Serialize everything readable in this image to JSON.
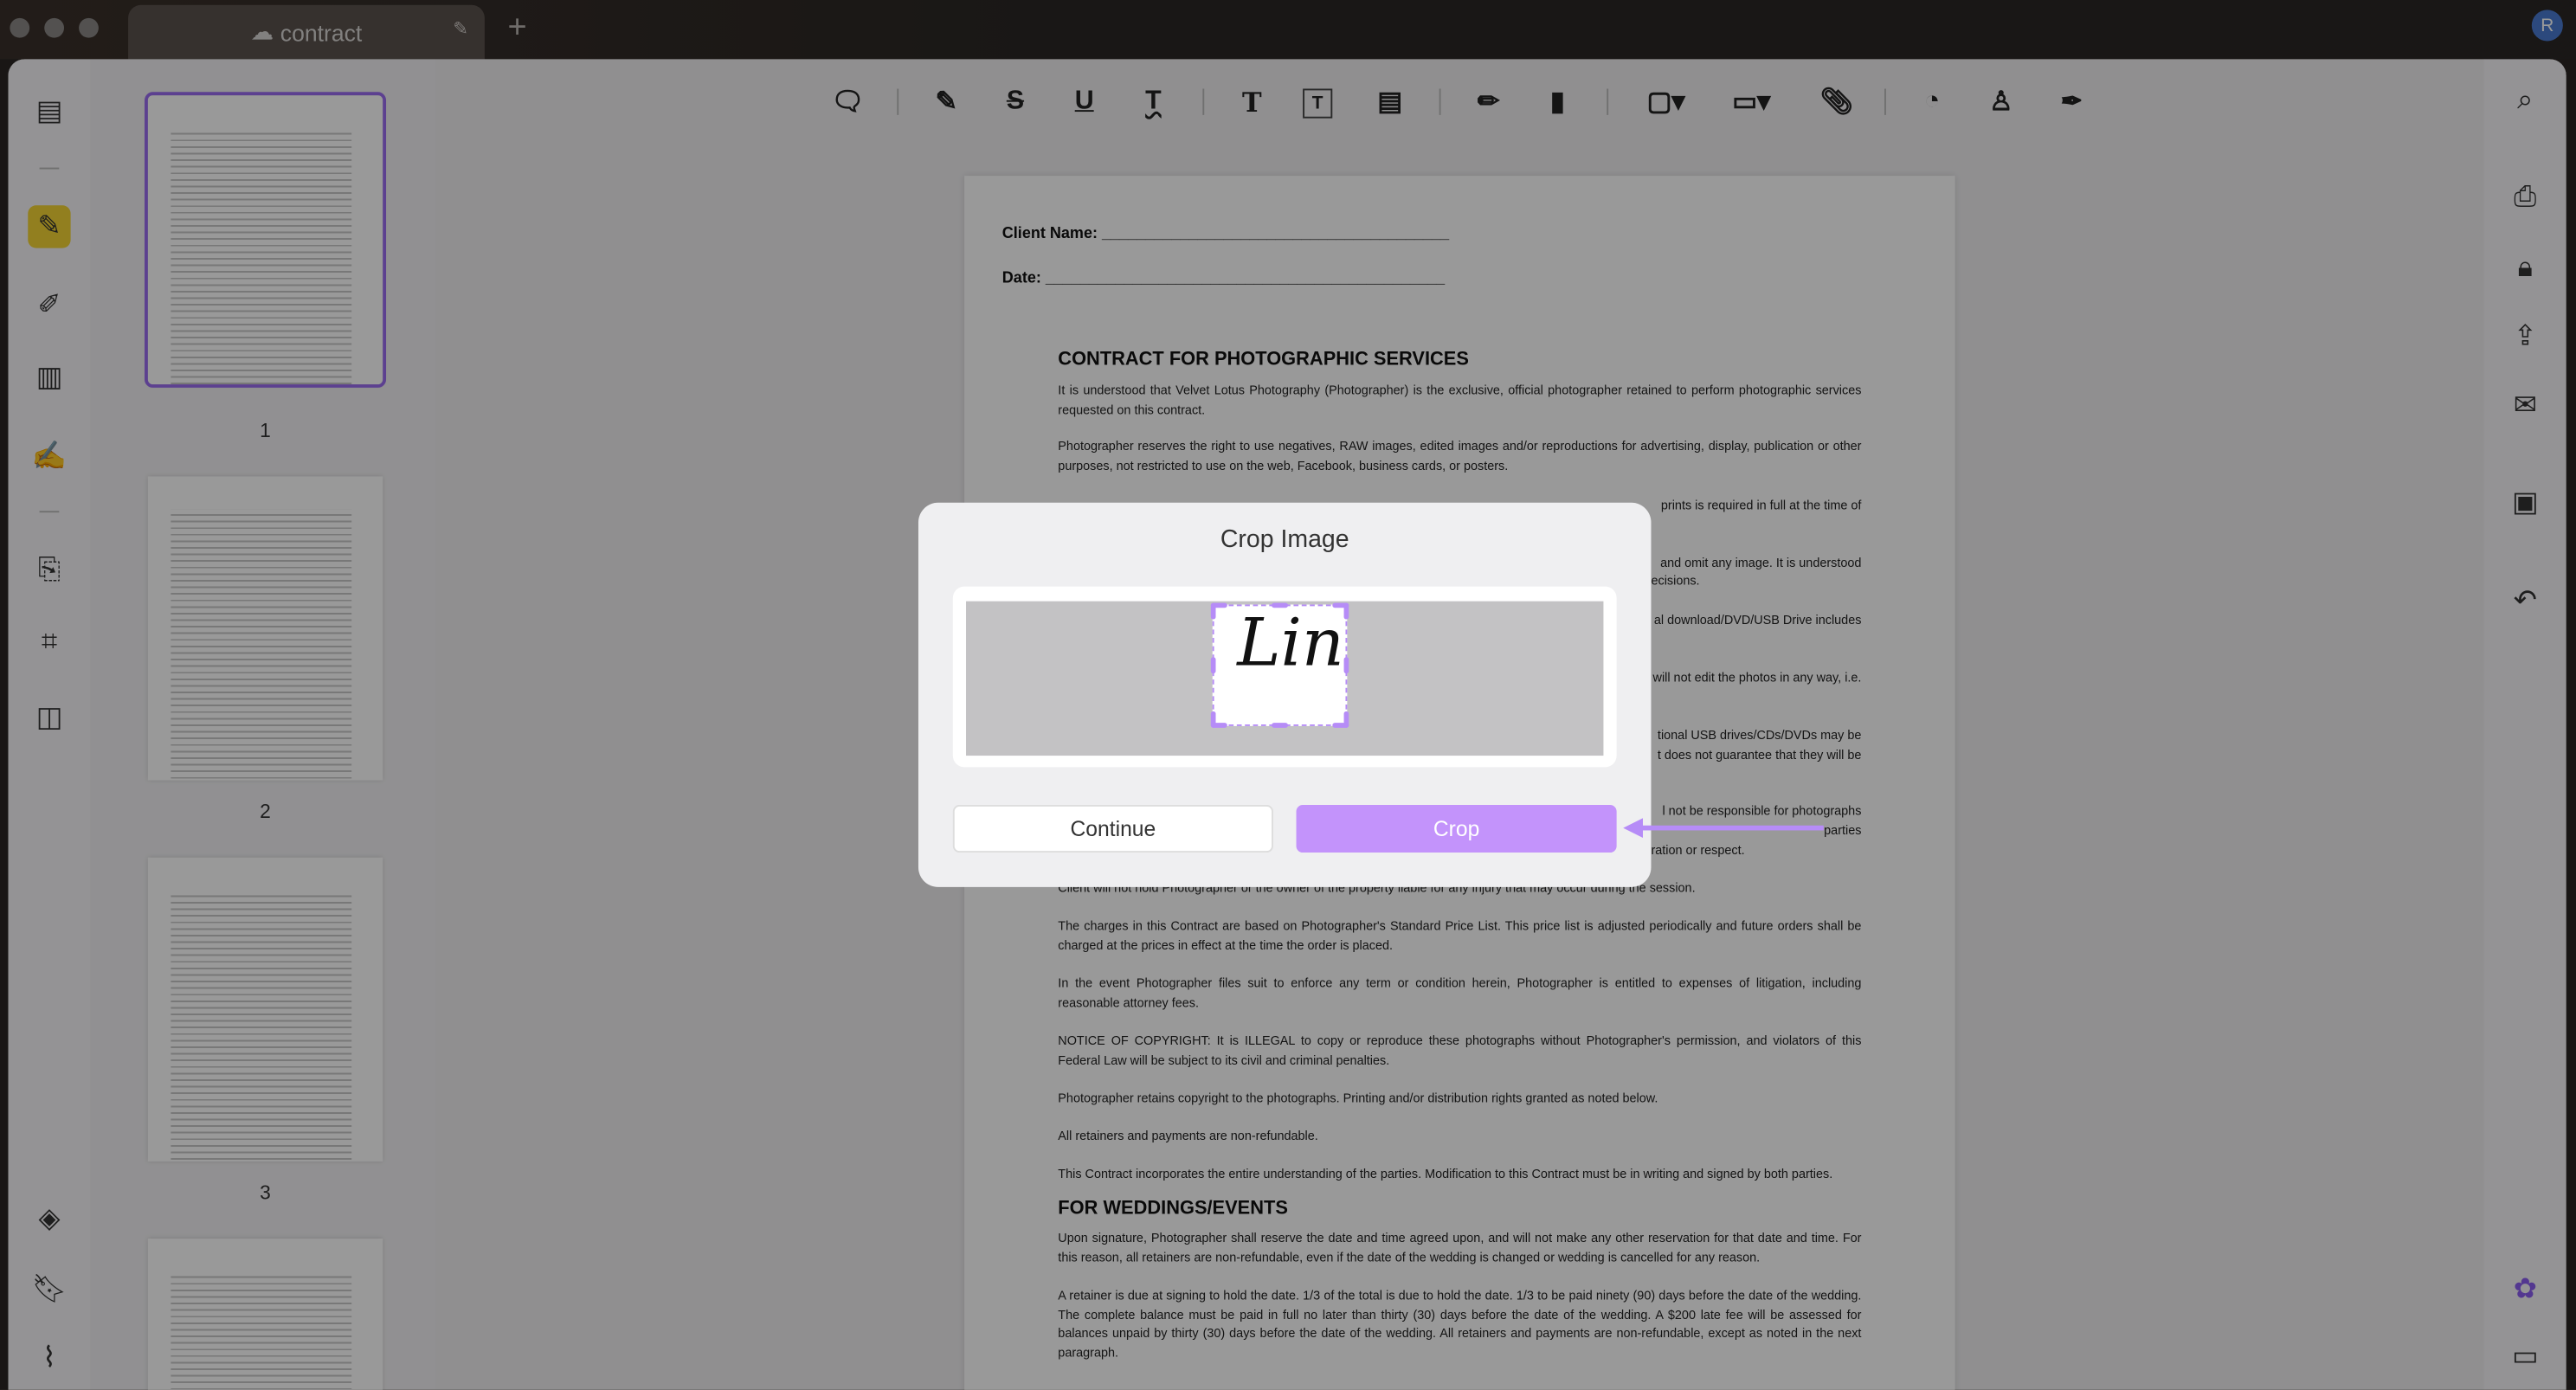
{
  "tab": {
    "title": "contract",
    "cloud_icon": "cloud-icon",
    "rename_icon": "pencil-icon",
    "new_tab_icon": "plus-icon"
  },
  "user": {
    "avatar_initial": "R",
    "avatar_color": "#4a7bd0"
  },
  "left_rail": {
    "icons": [
      "reader-icon",
      "comment-highlighter-icon",
      "edit-pdf-icon",
      "organize-pages-icon",
      "fill-sign-icon",
      "convert-icon",
      "crop-icon",
      "compress-icon",
      "layers-icon",
      "bookmark-icon",
      "attachment-icon"
    ],
    "active": "comment-highlighter-icon"
  },
  "thumbnails": [
    {
      "label": "1",
      "selected": true
    },
    {
      "label": "2"
    },
    {
      "label": "3"
    },
    {
      "label": ""
    }
  ],
  "toolbar": {
    "icons": [
      "comment-icon",
      "highlight-icon",
      "strikethrough-icon",
      "underline-icon",
      "squiggly-icon",
      "text-icon",
      "text-box-icon",
      "text-callout-icon",
      "pencil-icon",
      "eraser-icon",
      "shape-icon",
      "measure-icon",
      "attach-icon",
      "sticker-icon",
      "stamp-icon",
      "signature-icon"
    ]
  },
  "right_rail": {
    "icons": [
      "search-icon",
      "ocr-icon",
      "protect-icon",
      "share-icon",
      "email-icon",
      "save-icon",
      "undo-icon",
      "ai-assistant-icon",
      "chat-icon"
    ]
  },
  "document": {
    "client_name_label": "Client Name: ________________________________________",
    "date_label": "Date: ______________________________________________",
    "heading1": "CONTRACT FOR PHOTOGRAPHIC SERVICES",
    "p1": "It is understood that Velvet Lotus Photography (Photographer) is the exclusive, official photographer retained to perform photographic services requested on this contract.",
    "p2": "Photographer reserves the right to use negatives, RAW images, edited images and/or reproductions for advertising, display, publication or other purposes, not restricted to use on the web, Facebook, business cards, or posters.",
    "fragments": [
      "prints is required in full at the time of",
      "and omit any image. It is understood",
      "ecisions.",
      "al download/DVD/USB Drive includes",
      "will not edit the photos in any way, i.e.",
      "tional USB drives/CDs/DVDs may be",
      "t does not guarantee that they will be",
      "l not be responsible for photographs",
      "parties",
      "ration or respect."
    ],
    "p_session": "Client will not hold Photographer or the owner of the property liable for any injury that may occur during the session.",
    "p_charges": "The charges in this Contract are based on Photographer's Standard Price List. This price list is adjusted periodically and future orders shall be charged at the prices in effect at the time the order is placed.",
    "p_suit": "In the event Photographer files suit to enforce any term or condition herein, Photographer is entitled to expenses of litigation, including reasonable attorney fees.",
    "p_copyright": "NOTICE OF COPYRIGHT: It is ILLEGAL to copy or reproduce these photographs without Photographer's permission, and violators of this Federal Law will be subject to its civil and criminal penalties.",
    "p_retains": "Photographer retains copyright to the photographs. Printing and/or distribution rights granted as noted below.",
    "p_nonrefund": "All retainers and payments are non-refundable.",
    "p_entire": "This Contract incorporates the entire understanding of the parties. Modification to this Contract must be in writing and signed by both parties.",
    "heading2": "FOR WEDDINGS/EVENTS",
    "p_signature": "Upon signature, Photographer shall reserve the date and time agreed upon, and will not make any other reservation for that date and time. For this reason, all retainers are non-refundable, even if the date of the wedding is changed or wedding is cancelled for any reason.",
    "p_retainer": "A retainer is due at signing to hold the date. 1/3 of the total is due to hold the date. 1/3 to be paid ninety (90) days before the date of the wedding. The complete balance must be paid in full no later than thirty (30) days before the date of the wedding. A $200 late fee will be assessed for balances unpaid by thirty (30) days before the date of the wedding. All retainers and payments are non-refundable, except as noted in the next paragraph."
  },
  "dialog": {
    "title": "Crop Image",
    "signature_text": "Lin",
    "continue_label": "Continue",
    "crop_label": "Crop",
    "accent": "#c393fb"
  }
}
